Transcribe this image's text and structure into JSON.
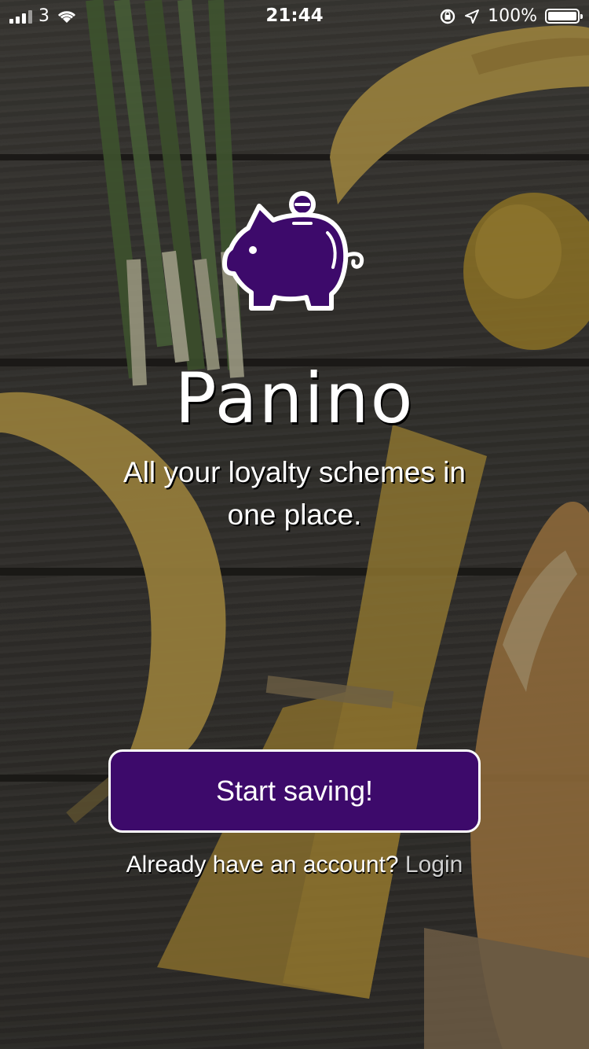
{
  "status_bar": {
    "carrier": "3",
    "time": "21:44",
    "battery_percent": "100%"
  },
  "app": {
    "title": "Panino",
    "tagline_line1": "All your loyalty schemes in",
    "tagline_line2": "one place.",
    "logo_icon": "piggy-bank-icon",
    "accent_color": "#3d0a6b"
  },
  "actions": {
    "start_label": "Start saving!",
    "login_prompt": "Already have an account?",
    "login_label": "Login"
  }
}
